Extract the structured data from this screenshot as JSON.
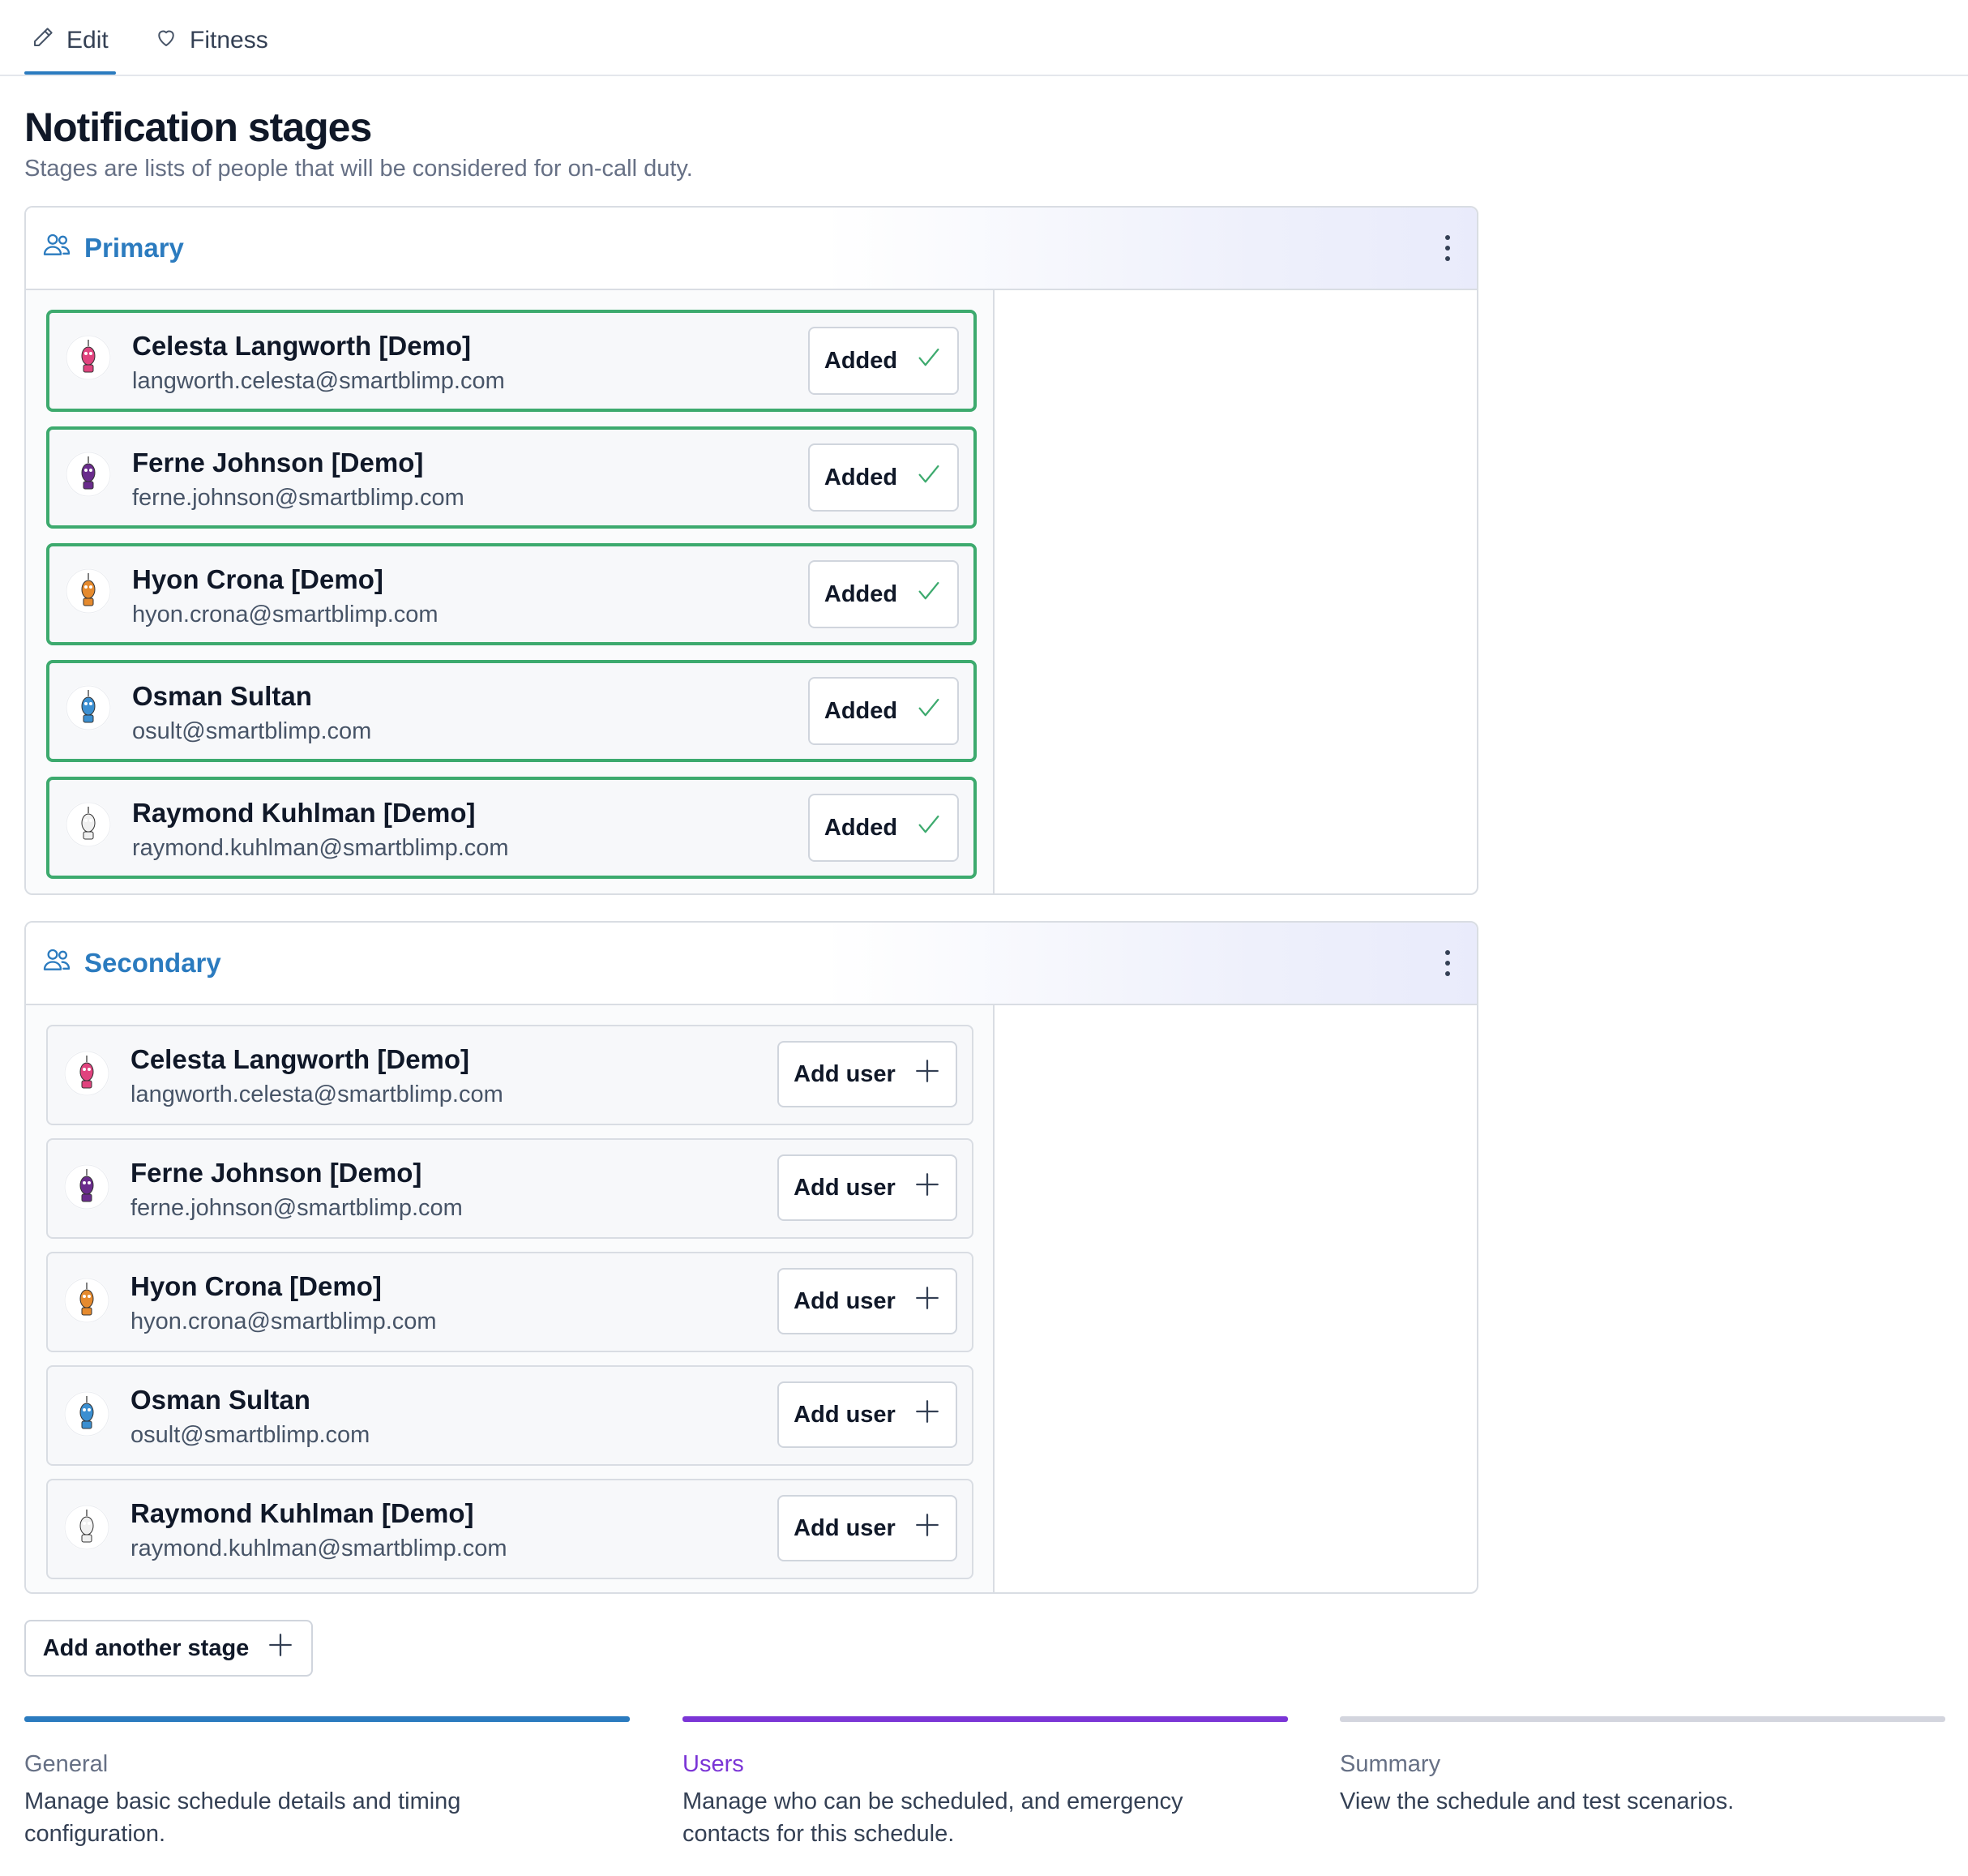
{
  "tabs": [
    {
      "label": "Edit",
      "icon": "pencil-icon",
      "active": true
    },
    {
      "label": "Fitness",
      "icon": "heart-icon",
      "active": false
    }
  ],
  "header": {
    "title": "Notification stages",
    "subtitle": "Stages are lists of people that will be considered for on-call duty."
  },
  "stages": [
    {
      "name": "Primary",
      "users": [
        {
          "name": "Celesta Langworth [Demo]",
          "email": "langworth.celesta@smartblimp.com",
          "action": "Added",
          "status": "added"
        },
        {
          "name": "Ferne Johnson [Demo]",
          "email": "ferne.johnson@smartblimp.com",
          "action": "Added",
          "status": "added"
        },
        {
          "name": "Hyon Crona [Demo]",
          "email": "hyon.crona@smartblimp.com",
          "action": "Added",
          "status": "added"
        },
        {
          "name": "Osman Sultan",
          "email": "osult@smartblimp.com",
          "action": "Added",
          "status": "added"
        },
        {
          "name": "Raymond Kuhlman [Demo]",
          "email": "raymond.kuhlman@smartblimp.com",
          "action": "Added",
          "status": "added"
        }
      ]
    },
    {
      "name": "Secondary",
      "users": [
        {
          "name": "Celesta Langworth [Demo]",
          "email": "langworth.celesta@smartblimp.com",
          "action": "Add user",
          "status": "not-added"
        },
        {
          "name": "Ferne Johnson [Demo]",
          "email": "ferne.johnson@smartblimp.com",
          "action": "Add user",
          "status": "not-added"
        },
        {
          "name": "Hyon Crona [Demo]",
          "email": "hyon.crona@smartblimp.com",
          "action": "Add user",
          "status": "not-added"
        },
        {
          "name": "Osman Sultan",
          "email": "osult@smartblimp.com",
          "action": "Add user",
          "status": "not-added"
        },
        {
          "name": "Raymond Kuhlman [Demo]",
          "email": "raymond.kuhlman@smartblimp.com",
          "action": "Add user",
          "status": "not-added"
        }
      ]
    }
  ],
  "add_stage_label": "Add another stage",
  "steps": [
    {
      "title": "General",
      "description": "Manage basic schedule details and timing configuration.",
      "state": "complete"
    },
    {
      "title": "Users",
      "description": "Manage who can be scheduled, and emergency contacts for this schedule.",
      "state": "current"
    },
    {
      "title": "Summary",
      "description": "View the schedule and test scenarios.",
      "state": "upcoming"
    }
  ],
  "colors": {
    "accent_blue": "#2b7bbf",
    "accent_purple": "#7b35d6",
    "added_green": "#3daa6e",
    "step_upcoming": "#d3d5de",
    "avatar_colors": [
      "#e0437e",
      "#6a2c8c",
      "#e58a2e",
      "#3b8fd1",
      "#f0f0f0"
    ]
  }
}
